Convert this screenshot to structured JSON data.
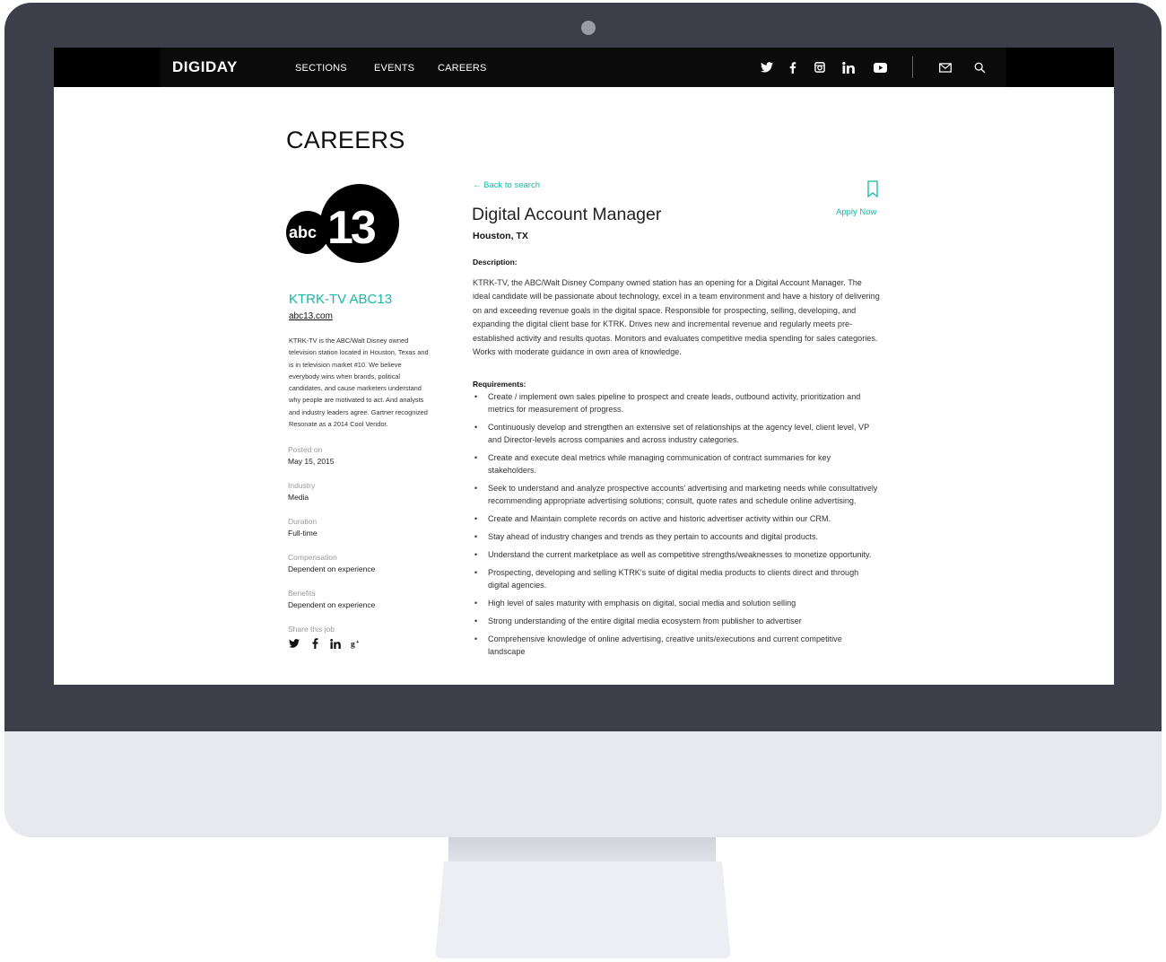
{
  "nav": {
    "logo": "DIGIDAY",
    "links": [
      "SECTIONS",
      "EVENTS",
      "CAREERS"
    ],
    "icons": [
      "twitter-icon",
      "facebook-icon",
      "instagram-icon",
      "linkedin-icon",
      "youtube-icon",
      "mail-icon",
      "search-icon"
    ]
  },
  "page": {
    "heading": "CAREERS"
  },
  "company": {
    "logo_text_abc": "abc",
    "logo_text_13": "13",
    "name": "KTRK-TV ABC13",
    "url": "abc13.com",
    "about": "KTRK-TV is the ABC/Walt Disney owned television station located in Houston, Texas and is in television market #10. We believe everybody wins when brands, political candidates, and cause marketers understand why people are motivated to act. And analysts and industry leaders agree. Gartner recognized Resonate as a 2014 Cool Vendor."
  },
  "meta": {
    "posted_label": "Posted on",
    "posted_value": "May 15, 2015",
    "industry_label": "Industry",
    "industry_value": "Media",
    "duration_label": "Duration",
    "duration_value": "Full-time",
    "compensation_label": "Compensation",
    "compensation_value": "Dependent on experience",
    "benefits_label": "Benefits",
    "benefits_value": "Dependent on experience",
    "share_label": "Share this job",
    "share_icons": [
      "twitter-icon",
      "facebook-icon",
      "linkedin-icon",
      "google-plus-icon"
    ]
  },
  "job": {
    "back_link": "Back to search",
    "apply": "Apply Now",
    "title": "Digital Account Manager",
    "location": "Houston, TX",
    "description_heading": "Description:",
    "description": "KTRK-TV, the ABC/Walt Disney Company owned station has an opening for a Digital Account Manager. The ideal candidate will be passionate about technology, excel in a team environment and have a history of delivering on and exceeding revenue goals in the digital space. Responsible for prospecting, selling, developing, and expanding the digital client base for KTRK. Drives new and incremental revenue and regularly meets pre-established activity and results quotas. Monitors and evaluates competitive media spending for sales categories. Works with moderate guidance in own area of knowledge.",
    "requirements_heading": "Requirements:",
    "requirements": [
      "Create / implement own sales pipeline to prospect and create leads, outbound activity, prioritization and metrics for measurement of progress.",
      "Continuously develop and strengthen an extensive set of relationships at the agency level, client level, VP and Director-levels across companies and across industry categories.",
      "Create and execute deal metrics while managing communication of contract summaries for key stakeholders.",
      "Seek to understand and analyze prospective accounts' advertising and marketing needs while consultatively recommending appropriate advertising solutions; consult, quote rates and schedule online advertising.",
      "Create and Maintain complete records on active and historic advertiser activity within our CRM.",
      "Stay ahead of industry changes and trends as they pertain to accounts and digital products.",
      "Understand the current marketplace as well as competitive strengths/weaknesses to monetize opportunity.",
      "Prospecting, developing and selling KTRK's suite of digital media products to clients direct and through digital agencies.",
      "High level of sales maturity with emphasis on digital, social media and solution selling",
      "Strong understanding of the entire digital media ecosystem from publisher to advertiser",
      "Comprehensive knowledge of online advertising, creative units/executions and current competitive landscape"
    ]
  }
}
